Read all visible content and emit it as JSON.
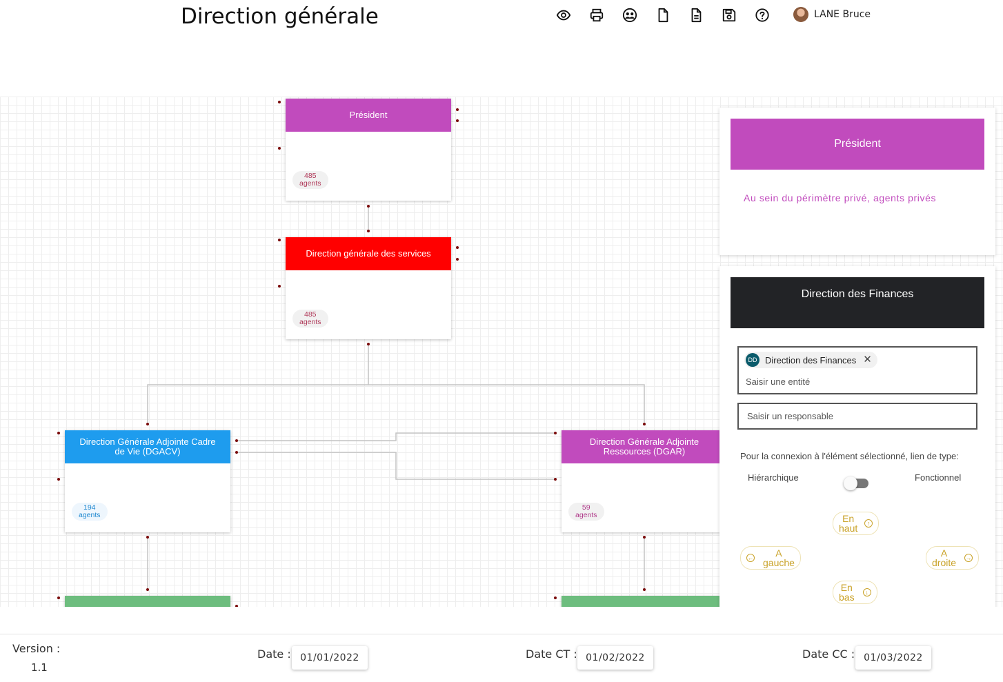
{
  "header": {
    "title": "Direction générale",
    "user_name": "LANE Bruce",
    "tools": [
      "eye-icon",
      "print-icon",
      "users-icon",
      "file-icon",
      "document-icon",
      "save-icon",
      "help-icon"
    ]
  },
  "org_chart": {
    "nodes": [
      {
        "id": "president",
        "label": "Président",
        "count": "485",
        "unit": "agents",
        "color": "#c14bbd"
      },
      {
        "id": "dgs",
        "label": "Direction générale des services",
        "count": "485",
        "unit": "agents",
        "color": "#ff0000"
      },
      {
        "id": "dgacv",
        "label": "Direction Générale Adjointe Cadre de Vie (DGACV)",
        "count": "194",
        "unit": "agents",
        "color": "#1e9cee"
      },
      {
        "id": "dgar",
        "label": "Direction Générale Adjointe Ressources (DGAR)",
        "count": "59",
        "unit": "agents",
        "color": "#c14bbd"
      }
    ]
  },
  "selected_node": {
    "title": "Président",
    "color": "#c14bbd",
    "description": "Au sein du périmètre privé, agents privés"
  },
  "connection": {
    "title": "Direction des Finances",
    "header_color": "#222326",
    "entity_chip": {
      "initials": "DD",
      "label": "Direction des Finances"
    },
    "entity_placeholder": "Saisir une entité",
    "responsable_placeholder": "Saisir un responsable",
    "link_type_label": "Pour la connexion à l'élément sélectionné, lien de type:",
    "option_left": "Hiérarchique",
    "option_right": "Fonctionnel",
    "buttons": {
      "up": {
        "l1": "En",
        "l2": "haut"
      },
      "left": {
        "l1": "A",
        "l2": "gauche"
      },
      "right": {
        "l1": "A",
        "l2": "droite"
      },
      "down": {
        "l1": "En",
        "l2": "bas"
      }
    },
    "accent_color": "#c9a227"
  },
  "footer": {
    "version_label": "Version :",
    "version_value": "1.1",
    "date_label": "Date :",
    "date_value": "01/01/2022",
    "date_ct_label": "Date CT :",
    "date_ct_value": "01/02/2022",
    "date_cc_label": "Date CC :",
    "date_cc_value": "01/03/2022"
  }
}
